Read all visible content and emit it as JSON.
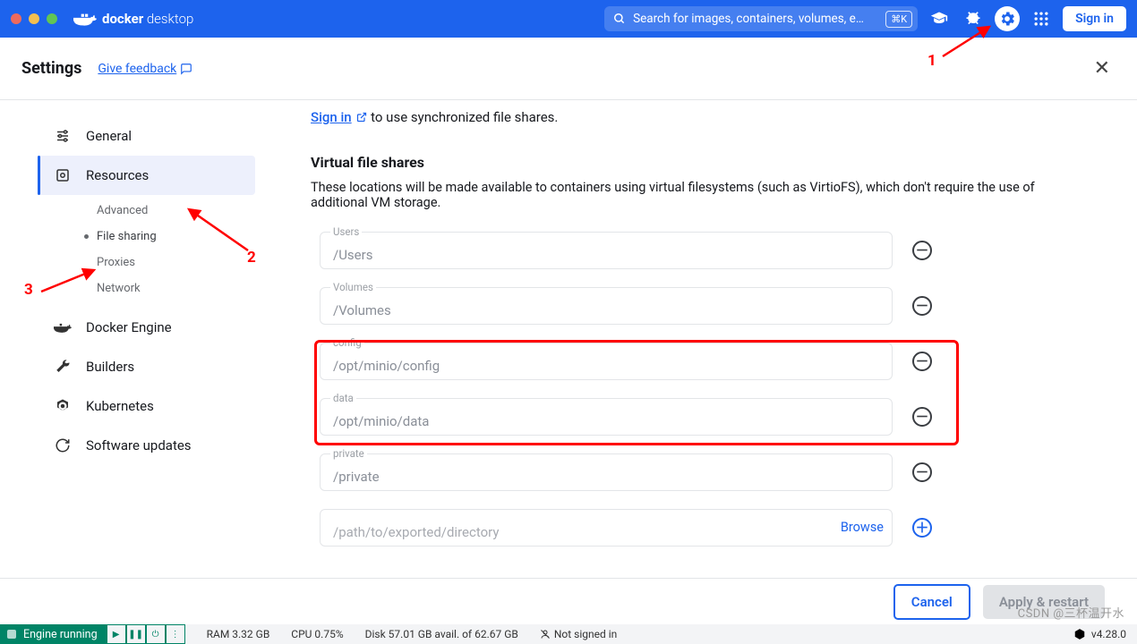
{
  "topbar": {
    "brand_bold": "docker",
    "brand_light": " desktop",
    "search_placeholder": "Search for images, containers, volumes, e…",
    "shortcut": "⌘K",
    "signin": "Sign in"
  },
  "header": {
    "title": "Settings",
    "feedback": "Give feedback"
  },
  "sidebar": {
    "items": [
      {
        "label": "General",
        "icon": "sliders"
      },
      {
        "label": "Resources",
        "icon": "db",
        "active": true
      },
      {
        "label": "Docker Engine",
        "icon": "whale"
      },
      {
        "label": "Builders",
        "icon": "wrench"
      },
      {
        "label": "Kubernetes",
        "icon": "helm"
      },
      {
        "label": "Software updates",
        "icon": "update"
      }
    ],
    "sub_items": [
      {
        "label": "Advanced"
      },
      {
        "label": "File sharing",
        "active": true
      },
      {
        "label": "Proxies"
      },
      {
        "label": "Network"
      }
    ]
  },
  "main": {
    "signin_prompt_link": "Sign in",
    "signin_prompt_rest": " to use synchronized file shares.",
    "section_title": "Virtual file shares",
    "section_desc": "These locations will be made available to containers using virtual filesystems (such as VirtioFS), which don't require the use of additional VM storage.",
    "shares": [
      {
        "label": "Users",
        "value": "/Users"
      },
      {
        "label": "Volumes",
        "value": "/Volumes"
      },
      {
        "label": "config",
        "value": "/opt/minio/config"
      },
      {
        "label": "data",
        "value": "/opt/minio/data"
      },
      {
        "label": "private",
        "value": "/private"
      }
    ],
    "add_placeholder": "/path/to/exported/directory",
    "browse": "Browse"
  },
  "actions": {
    "cancel": "Cancel",
    "apply": "Apply & restart"
  },
  "status": {
    "engine": "Engine running",
    "ram": "RAM 3.32 GB",
    "cpu": "CPU 0.75%",
    "disk": "Disk 57.01 GB avail. of 62.67 GB",
    "signed": "Not signed in",
    "version": "v4.28.0"
  },
  "annotations": {
    "n1": "1",
    "n2": "2",
    "n3": "3"
  },
  "watermark": "CSDN @三杯温开水"
}
